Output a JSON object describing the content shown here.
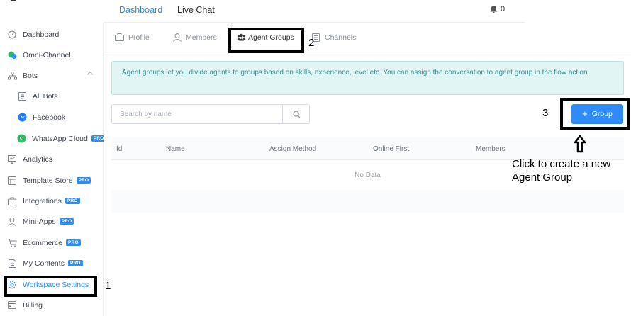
{
  "topbar": {
    "dashboard_label": "Dashboard",
    "live_chat_label": "Live Chat",
    "notification_count": "0"
  },
  "sidebar": {
    "items": [
      {
        "label": "Dashboard",
        "icon": "dashboard-icon"
      },
      {
        "label": "Omni-Channel",
        "icon": "omni-channel-icon"
      },
      {
        "label": "Bots",
        "icon": "bots-icon"
      },
      {
        "label": "All Bots",
        "icon": "all-bots-icon"
      },
      {
        "label": "Facebook",
        "icon": "messenger-icon"
      },
      {
        "label": "WhatsApp Cloud",
        "icon": "whatsapp-icon",
        "badge": "PRO"
      },
      {
        "label": "Analytics",
        "icon": "analytics-icon"
      },
      {
        "label": "Template Store",
        "icon": "template-store-icon",
        "badge": "PRO"
      },
      {
        "label": "Integrations",
        "icon": "integrations-icon",
        "badge": "PRO"
      },
      {
        "label": "Mini-Apps",
        "icon": "mini-apps-icon",
        "badge": "PRO"
      },
      {
        "label": "Ecommerce",
        "icon": "cart-icon",
        "badge": "PRO"
      },
      {
        "label": "My Contents",
        "icon": "contents-icon",
        "badge": "PRO"
      },
      {
        "label": "Workspace Settings",
        "icon": "gear-icon"
      },
      {
        "label": "Billing",
        "icon": "billing-icon"
      }
    ]
  },
  "tabs": [
    {
      "label": "Profile",
      "icon": "profile-icon"
    },
    {
      "label": "Members",
      "icon": "members-icon"
    },
    {
      "label": "Agent Groups",
      "icon": "agent-groups-icon"
    },
    {
      "label": "Channels",
      "icon": "channels-icon"
    }
  ],
  "alert": {
    "text": "Agent groups let you divide agents to groups based on skills, experience, level etc. You can assign the conversation to agent group in the flow action."
  },
  "search": {
    "placeholder": "Search by name"
  },
  "add_group_button": {
    "label": "Group"
  },
  "table": {
    "columns": [
      "Id",
      "Name",
      "Assign Method",
      "Online First",
      "Members"
    ],
    "empty_text": "No Data"
  },
  "annotations": {
    "marker_1": "1",
    "marker_2": "2",
    "marker_3": "3",
    "hint_line1": "Click to create a new",
    "hint_line2": "Agent Group"
  },
  "colors": {
    "accent": "#2f8cf6",
    "alert_bg": "#e1f5f5",
    "alert_text": "#3f8c93"
  }
}
